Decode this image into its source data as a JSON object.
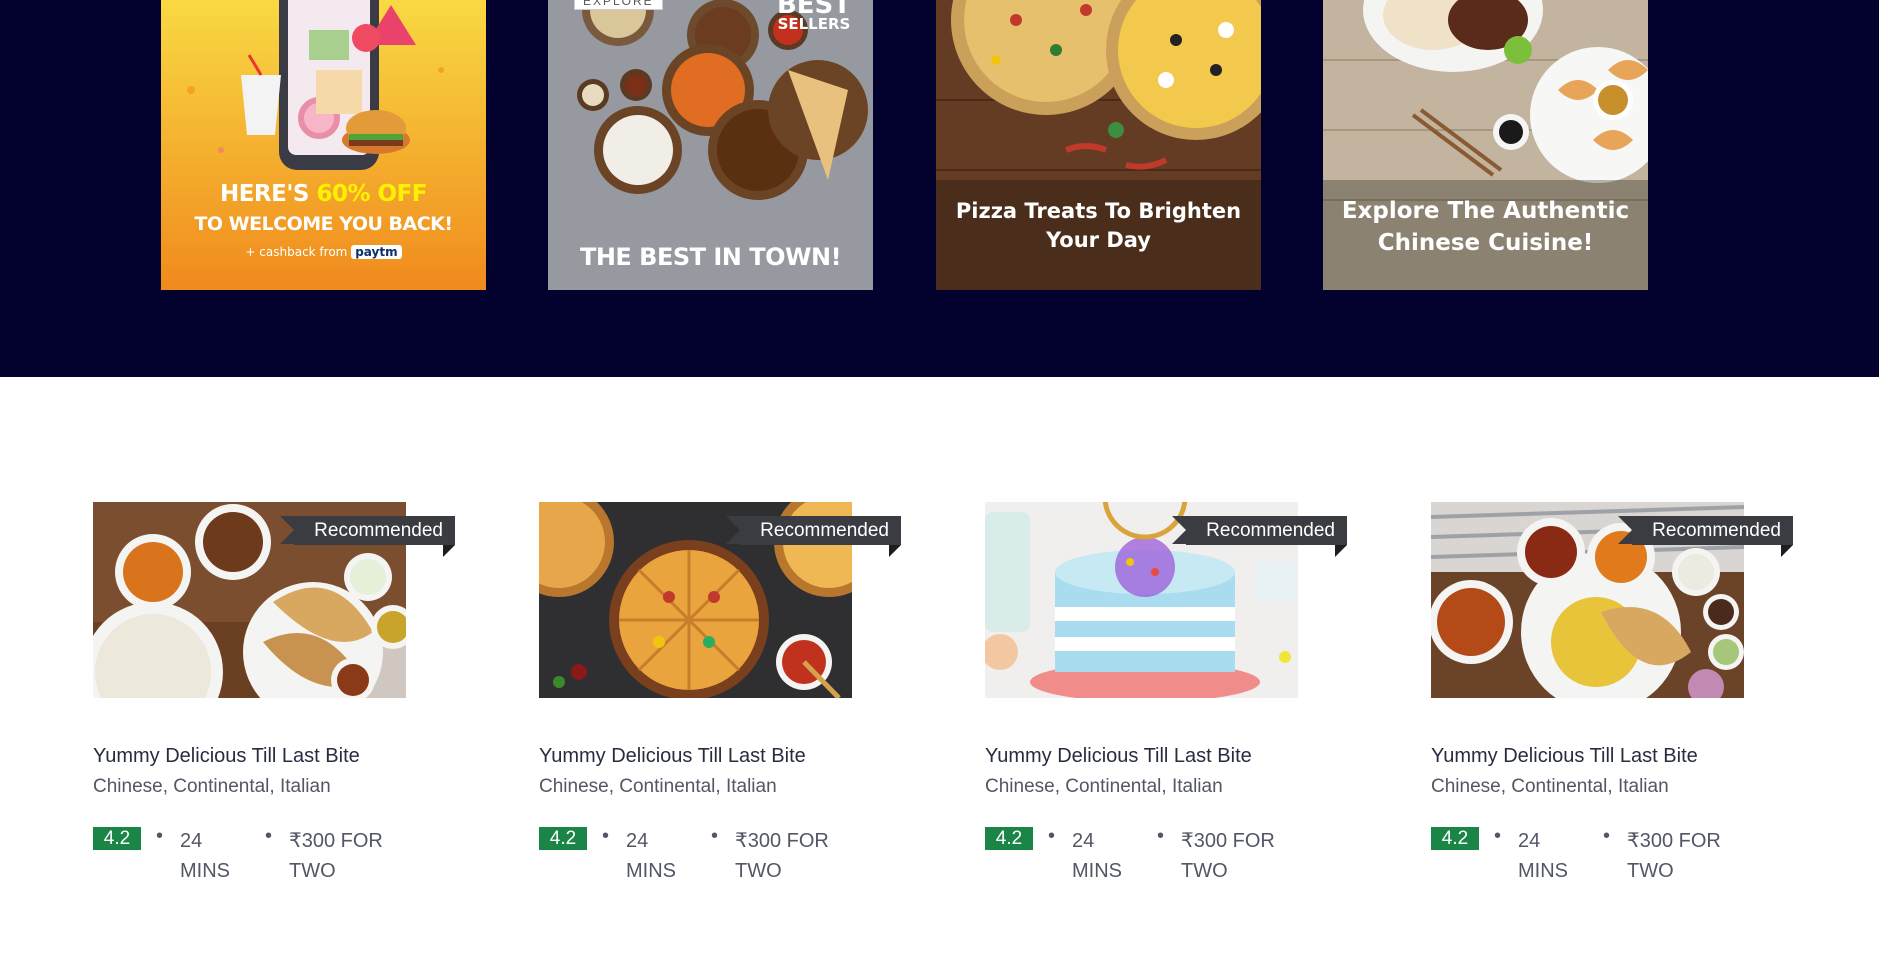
{
  "offers": [
    {
      "headline_pre": "HERE'S ",
      "headline_hl": "60% OFF",
      "line2": "TO WELCOME YOU BACK!",
      "line3": "+ cashback from",
      "brand": "paytm"
    },
    {
      "tag": "EXPLORE",
      "badge1": "BEST",
      "badge2": "SELLERS",
      "caption": "THE BEST IN TOWN!"
    },
    {
      "line1": "Pizza Treats To Brighten",
      "line2": "Your Day"
    },
    {
      "line1": "Explore The Authentic",
      "line2": "Chinese Cuisine!"
    }
  ],
  "restaurants": [
    {
      "ribbon": "Recommended",
      "name": "Yummy Delicious Till Last Bite",
      "cuisine": "Chinese, Continental, Italian",
      "rating": "4.2",
      "time_value": "24",
      "time_unit": "MINS",
      "cost_value": "₹300 FOR",
      "cost_unit": "TWO"
    },
    {
      "ribbon": "Recommended",
      "name": "Yummy Delicious Till Last Bite",
      "cuisine": "Chinese, Continental, Italian",
      "rating": "4.2",
      "time_value": "24",
      "time_unit": "MINS",
      "cost_value": "₹300 FOR",
      "cost_unit": "TWO"
    },
    {
      "ribbon": "Recommended",
      "name": "Yummy Delicious Till Last Bite",
      "cuisine": "Chinese, Continental, Italian",
      "rating": "4.2",
      "time_value": "24",
      "time_unit": "MINS",
      "cost_value": "₹300 FOR",
      "cost_unit": "TWO"
    },
    {
      "ribbon": "Recommended",
      "name": "Yummy Delicious Till Last Bite",
      "cuisine": "Chinese, Continental, Italian",
      "rating": "4.2",
      "time_value": "24",
      "time_unit": "MINS",
      "cost_value": "₹300 FOR",
      "cost_unit": "TWO"
    }
  ],
  "separator": "•",
  "colors": {
    "banner_bg": "#03022e",
    "rating_bg": "#1a8547",
    "ribbon_bg": "#3a3c41",
    "offer_highlight": "#fff200",
    "paytm_blue": "#00baf2"
  }
}
